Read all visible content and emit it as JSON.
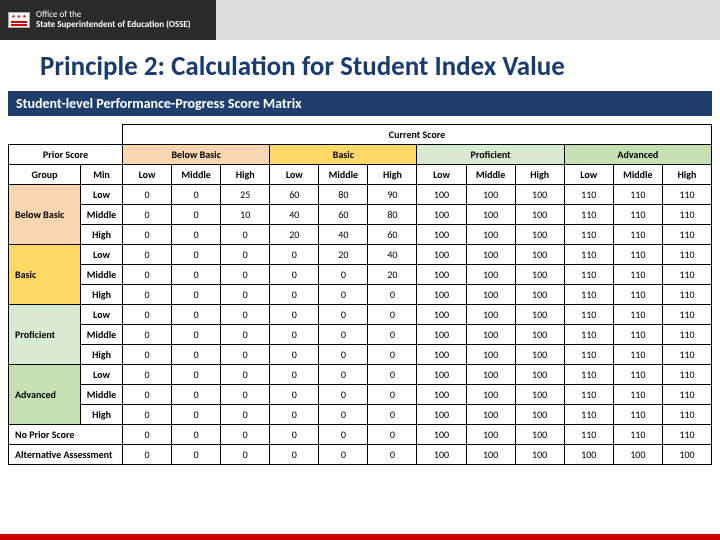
{
  "header": {
    "org_line1": "Office of the",
    "org_line2": "State Superintendent of Education (OSSE)"
  },
  "title": "Principle 2: Calculation for Student Index Value",
  "subtitle": "Student-level Performance-Progress Score Matrix",
  "matrix": {
    "prior_score_label": "Prior Score",
    "current_score_label": "Current Score",
    "group_label": "Group",
    "min_label": "Min",
    "col_groups": [
      "Below Basic",
      "Basic",
      "Proficient",
      "Advanced"
    ],
    "sub_cols": [
      "Low",
      "Middle",
      "High"
    ],
    "row_groups": [
      "Below Basic",
      "Basic",
      "Proficient",
      "Advanced"
    ],
    "sub_rows": [
      "Low",
      "Middle",
      "High"
    ],
    "extra_rows": [
      "No Prior Score",
      "Alternative Assessment"
    ],
    "data": [
      [
        0,
        0,
        25,
        60,
        80,
        90,
        100,
        100,
        100,
        110,
        110,
        110
      ],
      [
        0,
        0,
        10,
        40,
        60,
        80,
        100,
        100,
        100,
        110,
        110,
        110
      ],
      [
        0,
        0,
        0,
        20,
        40,
        60,
        100,
        100,
        100,
        110,
        110,
        110
      ],
      [
        0,
        0,
        0,
        0,
        20,
        40,
        100,
        100,
        100,
        110,
        110,
        110
      ],
      [
        0,
        0,
        0,
        0,
        0,
        20,
        100,
        100,
        100,
        110,
        110,
        110
      ],
      [
        0,
        0,
        0,
        0,
        0,
        0,
        100,
        100,
        100,
        110,
        110,
        110
      ],
      [
        0,
        0,
        0,
        0,
        0,
        0,
        100,
        100,
        100,
        110,
        110,
        110
      ],
      [
        0,
        0,
        0,
        0,
        0,
        0,
        100,
        100,
        100,
        110,
        110,
        110
      ],
      [
        0,
        0,
        0,
        0,
        0,
        0,
        100,
        100,
        100,
        110,
        110,
        110
      ],
      [
        0,
        0,
        0,
        0,
        0,
        0,
        100,
        100,
        100,
        110,
        110,
        110
      ],
      [
        0,
        0,
        0,
        0,
        0,
        0,
        100,
        100,
        100,
        110,
        110,
        110
      ],
      [
        0,
        0,
        0,
        0,
        0,
        0,
        100,
        100,
        100,
        110,
        110,
        110
      ],
      [
        0,
        0,
        0,
        0,
        0,
        0,
        100,
        100,
        100,
        110,
        110,
        110
      ],
      [
        0,
        0,
        0,
        0,
        0,
        0,
        100,
        100,
        100,
        100,
        100,
        100
      ]
    ]
  },
  "chart_data": {
    "type": "table",
    "title": "Student-level Performance-Progress Score Matrix",
    "row_labels": [
      "Below Basic / Low",
      "Below Basic / Middle",
      "Below Basic / High",
      "Basic / Low",
      "Basic / Middle",
      "Basic / High",
      "Proficient / Low",
      "Proficient / Middle",
      "Proficient / High",
      "Advanced / Low",
      "Advanced / Middle",
      "Advanced / High",
      "No Prior Score",
      "Alternative Assessment"
    ],
    "col_labels": [
      "Below Basic / Low",
      "Below Basic / Middle",
      "Below Basic / High",
      "Basic / Low",
      "Basic / Middle",
      "Basic / High",
      "Proficient / Low",
      "Proficient / Middle",
      "Proficient / High",
      "Advanced / Low",
      "Advanced / Middle",
      "Advanced / High"
    ],
    "values": [
      [
        0,
        0,
        25,
        60,
        80,
        90,
        100,
        100,
        100,
        110,
        110,
        110
      ],
      [
        0,
        0,
        10,
        40,
        60,
        80,
        100,
        100,
        100,
        110,
        110,
        110
      ],
      [
        0,
        0,
        0,
        20,
        40,
        60,
        100,
        100,
        100,
        110,
        110,
        110
      ],
      [
        0,
        0,
        0,
        0,
        20,
        40,
        100,
        100,
        100,
        110,
        110,
        110
      ],
      [
        0,
        0,
        0,
        0,
        0,
        20,
        100,
        100,
        100,
        110,
        110,
        110
      ],
      [
        0,
        0,
        0,
        0,
        0,
        0,
        100,
        100,
        100,
        110,
        110,
        110
      ],
      [
        0,
        0,
        0,
        0,
        0,
        0,
        100,
        100,
        100,
        110,
        110,
        110
      ],
      [
        0,
        0,
        0,
        0,
        0,
        0,
        100,
        100,
        100,
        110,
        110,
        110
      ],
      [
        0,
        0,
        0,
        0,
        0,
        0,
        100,
        100,
        100,
        110,
        110,
        110
      ],
      [
        0,
        0,
        0,
        0,
        0,
        0,
        100,
        100,
        100,
        110,
        110,
        110
      ],
      [
        0,
        0,
        0,
        0,
        0,
        0,
        100,
        100,
        100,
        110,
        110,
        110
      ],
      [
        0,
        0,
        0,
        0,
        0,
        0,
        100,
        100,
        100,
        110,
        110,
        110
      ],
      [
        0,
        0,
        0,
        0,
        0,
        0,
        100,
        100,
        100,
        110,
        110,
        110
      ],
      [
        0,
        0,
        0,
        0,
        0,
        0,
        100,
        100,
        100,
        100,
        100,
        100
      ]
    ]
  }
}
